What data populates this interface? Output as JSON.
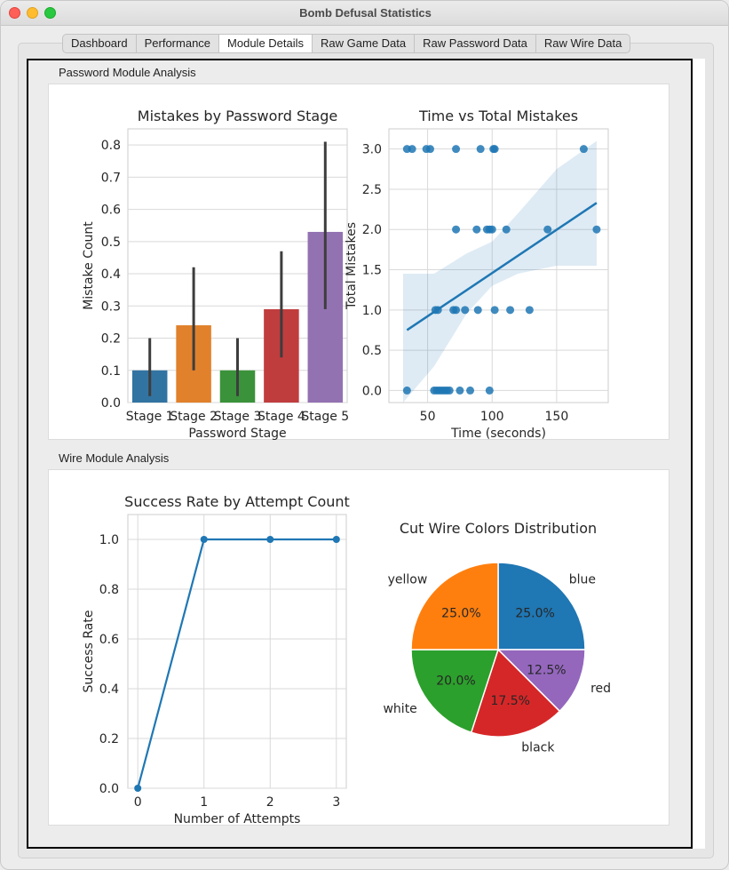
{
  "window": {
    "title": "Bomb Defusal Statistics"
  },
  "tabs": [
    {
      "label": "Dashboard",
      "active": false
    },
    {
      "label": "Performance",
      "active": false
    },
    {
      "label": "Module Details",
      "active": true
    },
    {
      "label": "Raw Game Data",
      "active": false
    },
    {
      "label": "Raw Password Data",
      "active": false
    },
    {
      "label": "Raw Wire Data",
      "active": false
    }
  ],
  "groups": {
    "password": {
      "title": "Password Module Analysis"
    },
    "wire": {
      "title": "Wire Module Analysis"
    }
  },
  "chart_data": [
    {
      "type": "bar",
      "title": "Mistakes by Password Stage",
      "xlabel": "Password Stage",
      "ylabel": "Mistake Count",
      "categories": [
        "Stage 1",
        "Stage 2",
        "Stage 3",
        "Stage 4",
        "Stage 5"
      ],
      "values": [
        0.1,
        0.24,
        0.1,
        0.29,
        0.53
      ],
      "error_low": [
        0.02,
        0.1,
        0.02,
        0.14,
        0.29
      ],
      "error_high": [
        0.2,
        0.42,
        0.2,
        0.47,
        0.81
      ],
      "colors": [
        "#3274a1",
        "#e1812c",
        "#3a923a",
        "#c03d3e",
        "#9372b2"
      ],
      "ylim": [
        0,
        0.85
      ],
      "yticks": [
        "0.0",
        "0.1",
        "0.2",
        "0.3",
        "0.4",
        "0.5",
        "0.6",
        "0.7",
        "0.8"
      ],
      "grid": true
    },
    {
      "type": "scatter",
      "title": "Time vs Total Mistakes",
      "xlabel": "Time (seconds)",
      "ylabel": "Total Mistakes",
      "xlim": [
        20,
        190
      ],
      "ylim": [
        -0.15,
        3.25
      ],
      "xticks": [
        50,
        100,
        150
      ],
      "yticks": [
        "0.0",
        "0.5",
        "1.0",
        "1.5",
        "2.0",
        "2.5",
        "3.0"
      ],
      "points": [
        [
          34,
          3
        ],
        [
          38,
          3
        ],
        [
          49,
          3
        ],
        [
          52,
          3
        ],
        [
          72,
          3
        ],
        [
          91,
          3
        ],
        [
          101,
          3
        ],
        [
          102,
          3
        ],
        [
          171,
          3
        ],
        [
          72,
          2
        ],
        [
          88,
          2
        ],
        [
          96,
          2
        ],
        [
          98,
          2
        ],
        [
          100,
          2
        ],
        [
          111,
          2
        ],
        [
          143,
          2
        ],
        [
          181,
          2
        ],
        [
          56,
          1
        ],
        [
          58,
          1
        ],
        [
          70,
          1
        ],
        [
          72,
          1
        ],
        [
          79,
          1
        ],
        [
          89,
          1
        ],
        [
          102,
          1
        ],
        [
          114,
          1
        ],
        [
          129,
          1
        ],
        [
          34,
          0
        ],
        [
          55,
          0
        ],
        [
          57,
          0
        ],
        [
          59,
          0
        ],
        [
          61,
          0
        ],
        [
          63,
          0
        ],
        [
          65,
          0
        ],
        [
          67,
          0
        ],
        [
          75,
          0
        ],
        [
          83,
          0
        ],
        [
          98,
          0
        ]
      ],
      "regression": {
        "x": [
          34,
          181
        ],
        "y": [
          0.75,
          2.33
        ]
      },
      "ci_band": {
        "x": [
          31,
          55,
          80,
          100,
          120,
          150,
          181
        ],
        "upper": [
          1.45,
          1.45,
          1.7,
          1.85,
          2.2,
          2.75,
          3.1
        ],
        "lower": [
          -0.15,
          0.3,
          0.95,
          1.3,
          1.45,
          1.55,
          1.55
        ]
      },
      "color": "#1f77b4",
      "grid": true
    },
    {
      "type": "line",
      "title": "Success Rate by Attempt Count",
      "xlabel": "Number of Attempts",
      "ylabel": "Success Rate",
      "x": [
        0,
        1,
        2,
        3
      ],
      "y": [
        0.0,
        1.0,
        1.0,
        1.0
      ],
      "xlim": [
        -0.15,
        3.15
      ],
      "ylim": [
        0,
        1.1
      ],
      "yticks": [
        "0.0",
        "0.2",
        "0.4",
        "0.6",
        "0.8",
        "1.0"
      ],
      "color": "#1f77b4",
      "grid": true
    },
    {
      "type": "pie",
      "title": "Cut Wire Colors Distribution",
      "slices": [
        {
          "label": "blue",
          "value": 25.0,
          "pct": "25.0%",
          "color": "#1f77b4"
        },
        {
          "label": "red",
          "value": 12.5,
          "pct": "12.5%",
          "color": "#9467bd"
        },
        {
          "label": "black",
          "value": 17.5,
          "pct": "17.5%",
          "color": "#d62728"
        },
        {
          "label": "white",
          "value": 20.0,
          "pct": "20.0%",
          "color": "#2ca02c"
        },
        {
          "label": "yellow",
          "value": 25.0,
          "pct": "25.0%",
          "color": "#ff7f0e"
        }
      ]
    }
  ]
}
